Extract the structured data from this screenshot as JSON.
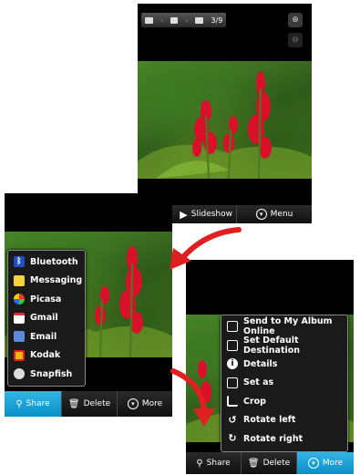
{
  "top": {
    "breadcrumb_counter": "3/9",
    "bottom_bar": {
      "slideshow_label": "Slideshow",
      "menu_label": "Menu"
    }
  },
  "left": {
    "share_menu": [
      "Bluetooth",
      "Messaging",
      "Picasa",
      "Gmail",
      "Email",
      "Kodak",
      "Snapfish"
    ],
    "bottom_bar": {
      "share_label": "Share",
      "delete_label": "Delete",
      "more_label": "More"
    }
  },
  "right": {
    "more_menu": [
      "Send to My Album Online",
      "Set Default Destination",
      "Details",
      "Set as",
      "Crop",
      "Rotate left",
      "Rotate right"
    ],
    "bottom_bar": {
      "share_label": "Share",
      "delete_label": "Delete",
      "more_label": "More"
    }
  },
  "colors": {
    "highlight": "#33b5e5",
    "arrow": "#e02020",
    "flower": "#d8102a"
  }
}
